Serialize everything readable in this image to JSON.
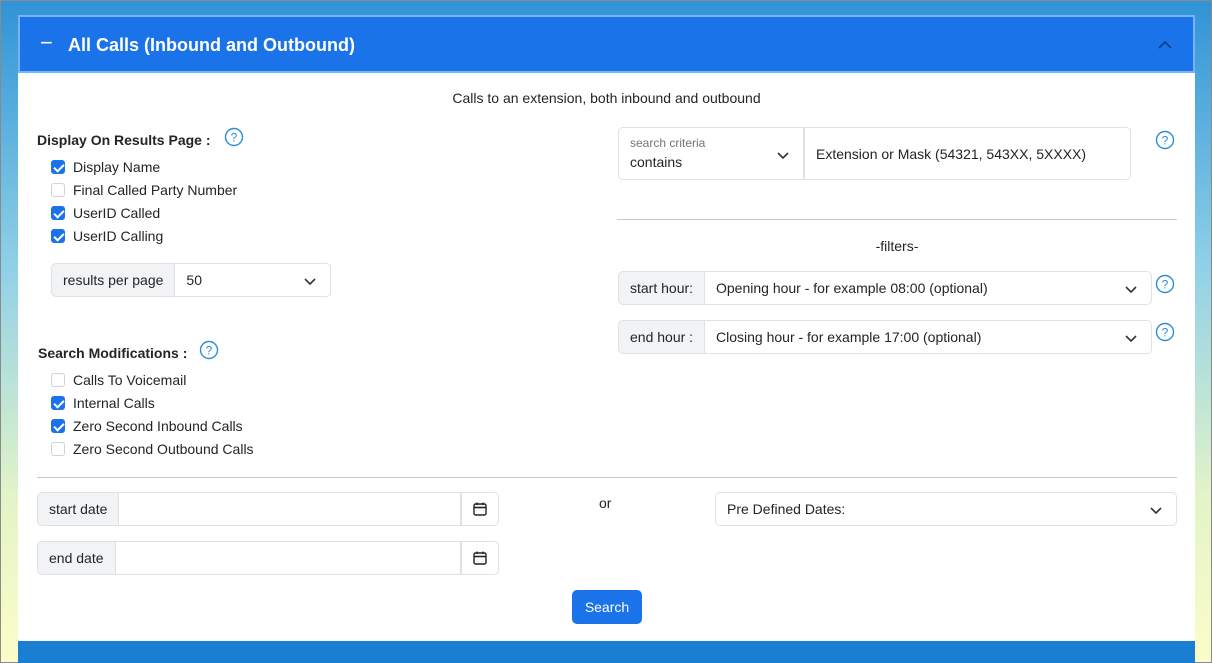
{
  "panel": {
    "title": "All Calls (Inbound and Outbound)",
    "collapse_symbol": "−",
    "subtitle": "Calls to an extension, both inbound and outbound"
  },
  "display": {
    "label": "Display On Results Page :",
    "help_icon": "question-circle-icon",
    "options": [
      {
        "label": "Display Name",
        "checked": true
      },
      {
        "label": "Final Called Party Number",
        "checked": false
      },
      {
        "label": "UserID Called",
        "checked": true
      },
      {
        "label": "UserID Calling",
        "checked": true
      }
    ],
    "results_label": "results per page",
    "results_value": "50"
  },
  "modifications": {
    "label": "Search Modifications :",
    "options": [
      {
        "label": "Calls To Voicemail",
        "checked": false
      },
      {
        "label": "Internal Calls",
        "checked": true
      },
      {
        "label": "Zero Second Inbound Calls",
        "checked": true
      },
      {
        "label": "Zero Second Outbound Calls",
        "checked": false
      }
    ]
  },
  "criteria": {
    "floating_label": "search criteria",
    "value": "contains",
    "placeholder": "Extension or Mask (54321, 543XX, 5XXXX)"
  },
  "filters": {
    "label": "-filters-",
    "start_hour_label": "start hour:",
    "start_hour_value": "Opening hour - for example 08:00 (optional)",
    "end_hour_label": "end hour :",
    "end_hour_value": "Closing hour - for example 17:00 (optional)"
  },
  "dates": {
    "start_label": "start date",
    "end_label": "end date",
    "or_label": "or",
    "predefined": "Pre Defined Dates:"
  },
  "search_button": "Search",
  "colors": {
    "primary": "#1a73e8",
    "help": "#2b8fd8"
  }
}
